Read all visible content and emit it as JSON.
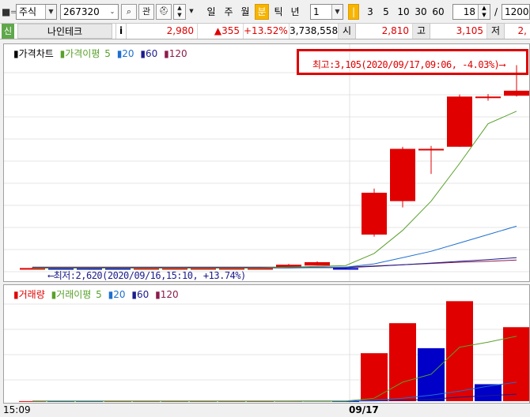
{
  "toolbar": {
    "market": "주식",
    "code": "267320",
    "btn_search": "⌕",
    "btn_gwan": "관",
    "periods": [
      "일",
      "주",
      "월",
      "분",
      "틱",
      "년"
    ],
    "active_period": "분",
    "interval": "1",
    "quick_intervals": [
      "3",
      "5",
      "10",
      "30",
      "60"
    ],
    "count": "18",
    "slash": "/",
    "total": "1200"
  },
  "quote": {
    "badge": "신",
    "name": "나인테크",
    "info": "i",
    "price": "2,980",
    "change": "▲355",
    "change_pct": "+13.52%",
    "volume": "3,738,558",
    "open_label": "시",
    "open": "2,810",
    "high_label": "고",
    "high": "3,105",
    "low_label": "저",
    "low": "2,"
  },
  "price_legend": {
    "chart": "가격차트",
    "ma_label": "가격이평",
    "ma5": "5",
    "ma20": "20",
    "ma60": "60",
    "ma120": "120"
  },
  "vol_legend": {
    "chart": "거래량",
    "ma_label": "거래이평",
    "ma5": "5",
    "ma20": "20",
    "ma60": "60",
    "ma120": "120"
  },
  "annotations": {
    "high": "최고:3,105(2020/09/17,09:06, -4.03%)⟶",
    "low": "⟵최저:2,620(2020/09/16,15:10, +13.74%)"
  },
  "x_axis": {
    "left_label": "15:09",
    "day_label": "09/17"
  },
  "colors": {
    "up": "#e00000",
    "down": "#0000c8",
    "ma5": "#5aa02c",
    "ma20": "#1f6fd0",
    "ma60": "#1c1c8c",
    "ma120": "#8c1c4c",
    "highlight": "#e00000"
  },
  "chart_data": {
    "type": "candlestick",
    "price_range": [
      2600,
      3140
    ],
    "candles": [
      {
        "o": 2620,
        "h": 2622,
        "l": 2618,
        "c": 2620
      },
      {
        "o": 2620,
        "h": 2621,
        "l": 2617,
        "c": 2618
      },
      {
        "o": 2620,
        "h": 2621,
        "l": 2616,
        "c": 2617
      },
      {
        "o": 2620,
        "h": 2621,
        "l": 2618,
        "c": 2619
      },
      {
        "o": 2620,
        "h": 2621,
        "l": 2619,
        "c": 2620
      },
      {
        "o": 2620,
        "h": 2621,
        "l": 2619,
        "c": 2620
      },
      {
        "o": 2620,
        "h": 2621,
        "l": 2619,
        "c": 2620
      },
      {
        "o": 2620,
        "h": 2621,
        "l": 2619,
        "c": 2620
      },
      {
        "o": 2620,
        "h": 2621,
        "l": 2619,
        "c": 2620
      },
      {
        "o": 2621,
        "h": 2630,
        "l": 2621,
        "c": 2628
      },
      {
        "o": 2626,
        "h": 2636,
        "l": 2626,
        "c": 2634
      },
      {
        "o": 2620,
        "h": 2622,
        "l": 2618,
        "c": 2619
      },
      {
        "o": 2700,
        "h": 2810,
        "l": 2695,
        "c": 2800
      },
      {
        "o": 2780,
        "h": 2910,
        "l": 2765,
        "c": 2905
      },
      {
        "o": 2905,
        "h": 2912,
        "l": 2845,
        "c": 2905
      },
      {
        "o": 2910,
        "h": 3035,
        "l": 2910,
        "c": 3030
      },
      {
        "o": 3030,
        "h": 3036,
        "l": 3020,
        "c": 3030
      },
      {
        "o": 3032,
        "h": 3105,
        "l": 3030,
        "c": 3044
      }
    ],
    "ma5": [
      2620,
      2620,
      2620,
      2620,
      2620,
      2620,
      2620,
      2620,
      2620,
      2622,
      2624,
      2626,
      2655,
      2710,
      2780,
      2870,
      2965,
      2995
    ],
    "ma20": [
      2620,
      2620,
      2620,
      2620,
      2620,
      2620,
      2620,
      2620,
      2620,
      2620,
      2621,
      2622,
      2630,
      2645,
      2660,
      2680,
      2700,
      2720
    ],
    "ma60": [
      2621,
      2621,
      2621,
      2621,
      2621,
      2621,
      2621,
      2621,
      2621,
      2621,
      2621,
      2621,
      2624,
      2628,
      2632,
      2636,
      2640,
      2645
    ],
    "ma120": [
      2622,
      2622,
      2622,
      2622,
      2622,
      2622,
      2622,
      2622,
      2622,
      2622,
      2622,
      2622,
      2625,
      2628,
      2631,
      2634,
      2636,
      2639
    ],
    "volume": [
      1,
      1,
      1,
      1,
      1,
      1,
      1,
      1,
      1,
      2,
      3,
      1,
      480,
      780,
      530,
      1000,
      170,
      740
    ],
    "volume_up": [
      true,
      false,
      false,
      true,
      true,
      true,
      true,
      true,
      true,
      true,
      true,
      false,
      true,
      true,
      false,
      true,
      false,
      true
    ],
    "vol_ma5": [
      1,
      1,
      1,
      1,
      1,
      1,
      1,
      1,
      1,
      1,
      2,
      2,
      30,
      190,
      270,
      540,
      590,
      650
    ],
    "vol_ma20": [
      1,
      1,
      1,
      1,
      1,
      1,
      1,
      1,
      1,
      1,
      1,
      1,
      10,
      30,
      60,
      100,
      150,
      190
    ],
    "vol_ma60": [
      1,
      1,
      1,
      1,
      1,
      1,
      1,
      1,
      1,
      1,
      1,
      1,
      3,
      10,
      20,
      40,
      55,
      70
    ],
    "vol_range": [
      0,
      1050
    ]
  }
}
